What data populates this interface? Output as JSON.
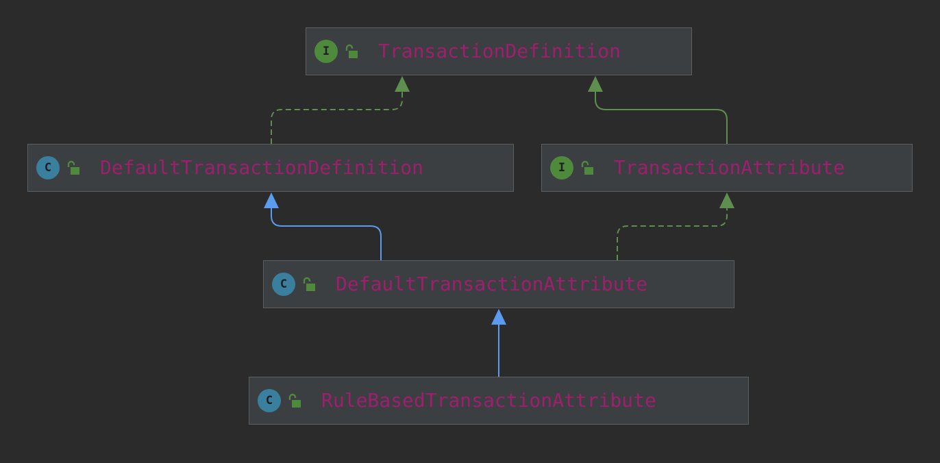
{
  "diagram": {
    "colors": {
      "background": "#2b2b2b",
      "node_fill": "#3c3f41",
      "node_border": "#5e6060",
      "name_text": "#9d1f6e",
      "interface_icon": "#4f8a3c",
      "class_icon": "#3b7f9e",
      "lock_icon": "#4f8a3c",
      "extends_edge": "#5b9bf0",
      "implements_edge": "#5e8f4e"
    },
    "nodes": [
      {
        "id": "transaction-definition",
        "kind": "interface",
        "icon_letter": "I",
        "icon": "interface-icon",
        "access_icon": "public-lock-icon",
        "name": "TransactionDefinition"
      },
      {
        "id": "default-transaction-definition",
        "kind": "class",
        "icon_letter": "C",
        "icon": "class-icon",
        "access_icon": "public-lock-icon",
        "name": "DefaultTransactionDefinition"
      },
      {
        "id": "transaction-attribute",
        "kind": "interface",
        "icon_letter": "I",
        "icon": "interface-icon",
        "access_icon": "public-lock-icon",
        "name": "TransactionAttribute"
      },
      {
        "id": "default-transaction-attribute",
        "kind": "class",
        "icon_letter": "C",
        "icon": "class-icon",
        "access_icon": "public-lock-icon",
        "name": "DefaultTransactionAttribute"
      },
      {
        "id": "rule-based-transaction-attribute",
        "kind": "class",
        "icon_letter": "C",
        "icon": "class-icon",
        "access_icon": "public-lock-icon",
        "name": "RuleBasedTransactionAttribute"
      }
    ],
    "edges": [
      {
        "from": "default-transaction-definition",
        "to": "transaction-definition",
        "relation": "implements",
        "style": "dashed"
      },
      {
        "from": "transaction-attribute",
        "to": "transaction-definition",
        "relation": "extends",
        "style": "solid"
      },
      {
        "from": "default-transaction-attribute",
        "to": "default-transaction-definition",
        "relation": "extends",
        "style": "solid"
      },
      {
        "from": "default-transaction-attribute",
        "to": "transaction-attribute",
        "relation": "implements",
        "style": "dashed"
      },
      {
        "from": "rule-based-transaction-attribute",
        "to": "default-transaction-attribute",
        "relation": "extends",
        "style": "solid"
      }
    ]
  }
}
